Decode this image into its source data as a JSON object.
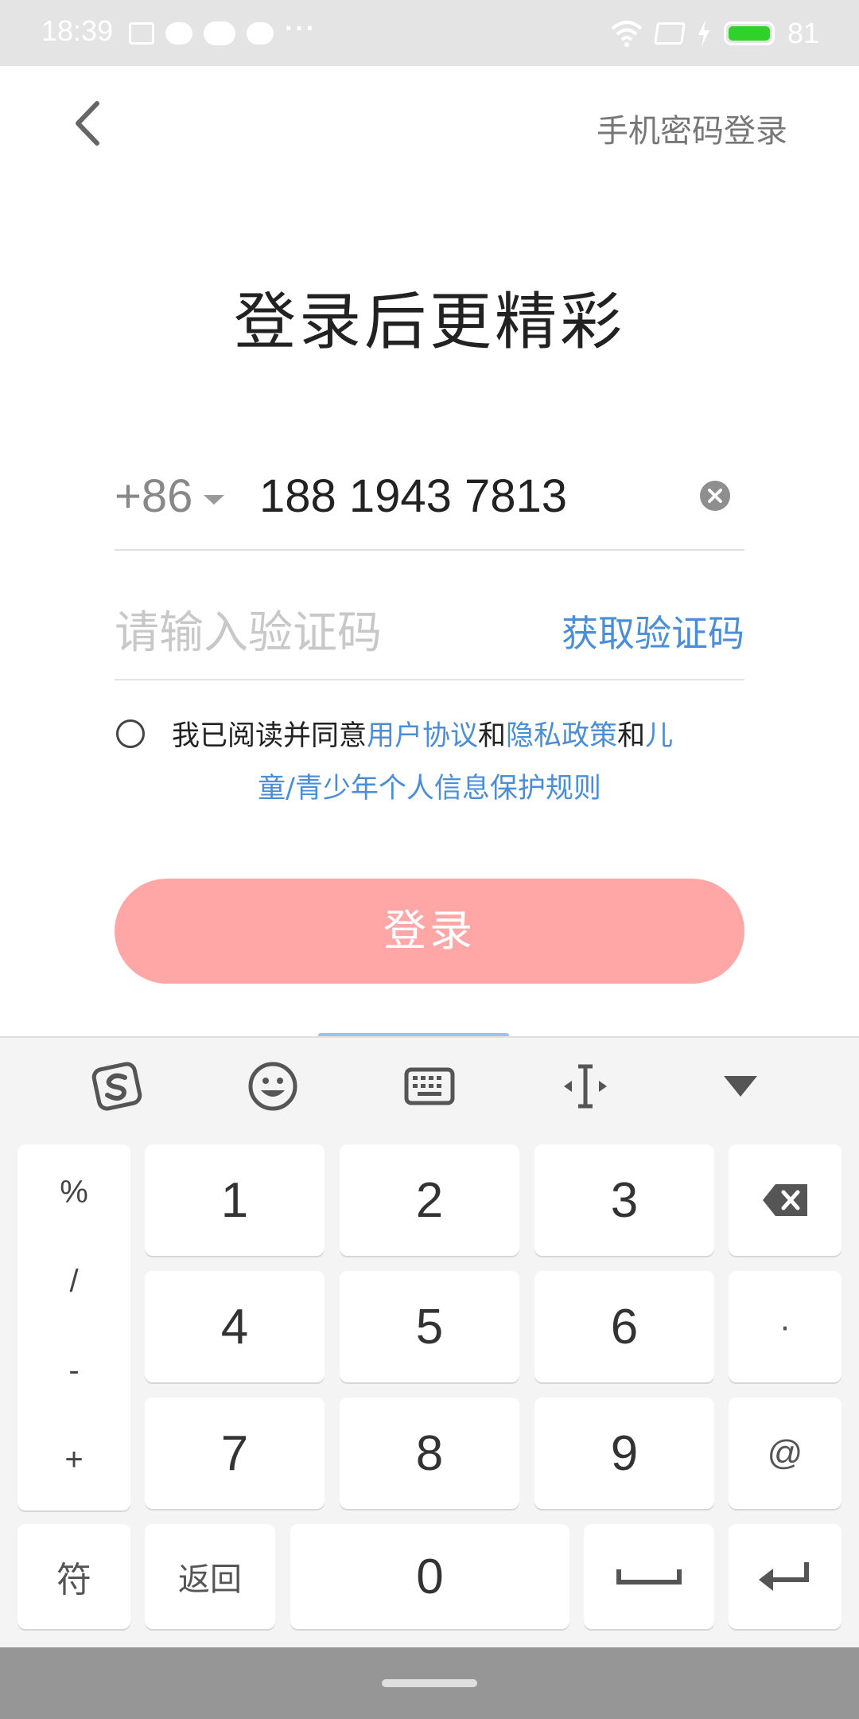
{
  "status_bar": {
    "time": "18:39",
    "battery": "81",
    "icons_left": [
      "news-icon",
      "chat-bubble-icon",
      "cloud-icon",
      "chat-bubble-icon",
      "more-dots-icon"
    ],
    "icons_right": [
      "wifi-icon",
      "screen-icon",
      "charging-icon",
      "battery-icon"
    ],
    "battery_color": "#2fd12a"
  },
  "header": {
    "back_icon": "chevron-left-icon",
    "password_login": "手机密码登录"
  },
  "title": "登录后更精彩",
  "phone": {
    "country_code": "+86",
    "number": "188 1943 7813",
    "clear_icon": "clear-circle-icon"
  },
  "verification": {
    "placeholder": "请输入验证码",
    "get_code": "获取验证码"
  },
  "agreement": {
    "prefix": "我已阅读并同意",
    "user_agreement": "用户协议",
    "and1": "和",
    "privacy_policy": "隐私政策",
    "and2": "和",
    "children_part1": "儿",
    "children_part2": "童/青少年个人信息保护规则"
  },
  "login_button": "登录",
  "colors": {
    "accent_link": "#4a8ed8",
    "login_button": "#fea7a6"
  },
  "keyboard": {
    "toolbar": [
      "sogou-icon",
      "emoji-icon",
      "keyboard-icon",
      "cursor-icon",
      "collapse-icon"
    ],
    "symbols": [
      "%",
      "/",
      "-",
      "+"
    ],
    "keys": {
      "k1": "1",
      "k2": "2",
      "k3": "3",
      "k4": "4",
      "k5": "5",
      "k6": "6",
      "k7": "7",
      "k8": "8",
      "k9": "9",
      "k0": "0",
      "dot": "·",
      "at": "@",
      "symbols": "符",
      "back": "返回"
    },
    "right_icons": [
      "backspace-icon",
      "space-icon",
      "enter-icon"
    ]
  }
}
